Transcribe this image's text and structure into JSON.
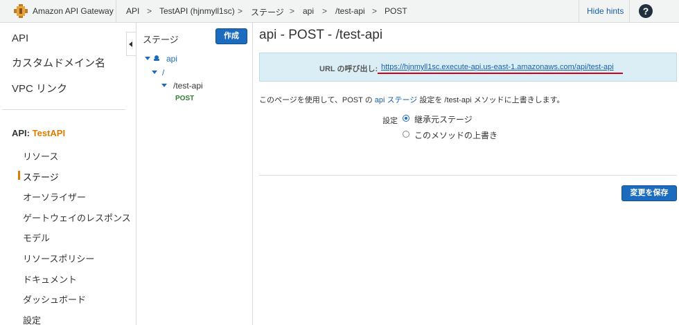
{
  "topbar": {
    "brand": "Amazon API Gateway",
    "breadcrumbs": [
      "API",
      "TestAPI (hjnmyll1sc)",
      "ステージ",
      "api",
      "/test-api",
      "POST"
    ],
    "separator": ">",
    "hide_hints": "Hide hints",
    "help_symbol": "?"
  },
  "leftnav": {
    "top_items": [
      "API",
      "カスタムドメイン名",
      "VPC リンク"
    ],
    "api_prefix": "API:",
    "api_name": "TestAPI",
    "items": [
      "リソース",
      "ステージ",
      "オーソライザー",
      "ゲートウェイのレスポンス",
      "モデル",
      "リソースポリシー",
      "ドキュメント",
      "ダッシュボード",
      "設定"
    ],
    "active_index": 1
  },
  "tree": {
    "title": "ステージ",
    "create_label": "作成",
    "stage": "api",
    "root": "/",
    "resource": "/test-api",
    "method": "POST"
  },
  "main": {
    "title": "api - POST - /test-api",
    "url_label": "URL の呼び出し:",
    "url": "https://hjnmyll1sc.execute-api.us-east-1.amazonaws.com/api/test-api",
    "desc_before": "このページを使用して、POST の ",
    "desc_link": "api ステージ",
    "desc_after": " 設定を /test-api メソッドに上書きします。",
    "setting_label": "設定",
    "options": [
      {
        "label": "継承元ステージ",
        "selected": true
      },
      {
        "label": "このメソッドの上書き",
        "selected": false
      }
    ],
    "save_label": "変更を保存"
  },
  "colors": {
    "accent_orange": "#e07b00",
    "link_blue": "#1a5fa8",
    "button_blue": "#1b6bbf",
    "info_bg": "#dbeef6",
    "annotation_red": "#d0021b",
    "method_green": "#2f7d32"
  }
}
